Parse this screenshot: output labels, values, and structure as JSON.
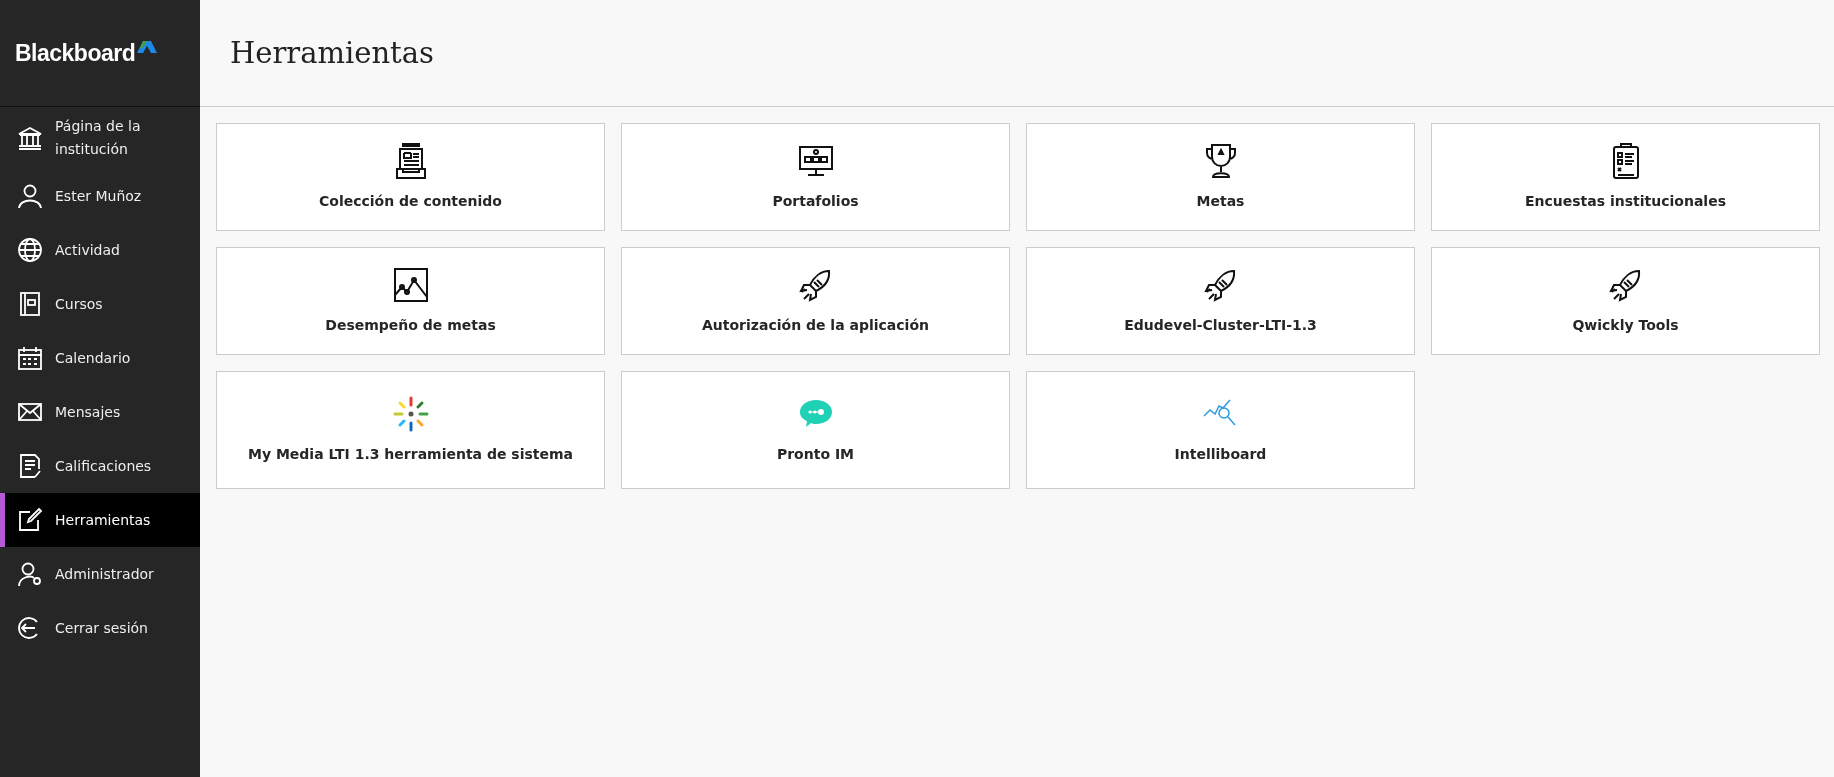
{
  "sidebar": {
    "logo": "Blackboard",
    "items": [
      {
        "label": "Página de la institución",
        "selected": false
      },
      {
        "label": "Ester Muñoz",
        "selected": false
      },
      {
        "label": "Actividad",
        "selected": false
      },
      {
        "label": "Cursos",
        "selected": false
      },
      {
        "label": "Calendario",
        "selected": false
      },
      {
        "label": "Mensajes",
        "selected": false
      },
      {
        "label": "Calificaciones",
        "selected": false
      },
      {
        "label": "Herramientas",
        "selected": true
      },
      {
        "label": "Administrador",
        "selected": false
      },
      {
        "label": "Cerrar sesión",
        "selected": false
      }
    ]
  },
  "page": {
    "title": "Herramientas"
  },
  "tools": [
    {
      "label": "Colección de contenido"
    },
    {
      "label": "Portafolios"
    },
    {
      "label": "Metas"
    },
    {
      "label": "Encuestas institucionales"
    },
    {
      "label": "Desempeño de metas"
    },
    {
      "label": "Autorización de la aplicación"
    },
    {
      "label": "Edudevel-Cluster-LTI-1.3"
    },
    {
      "label": "Qwickly Tools"
    },
    {
      "label": "My Media LTI 1.3 herramienta de sistema"
    },
    {
      "label": "Pronto IM"
    },
    {
      "label": "Intelliboard"
    }
  ]
}
